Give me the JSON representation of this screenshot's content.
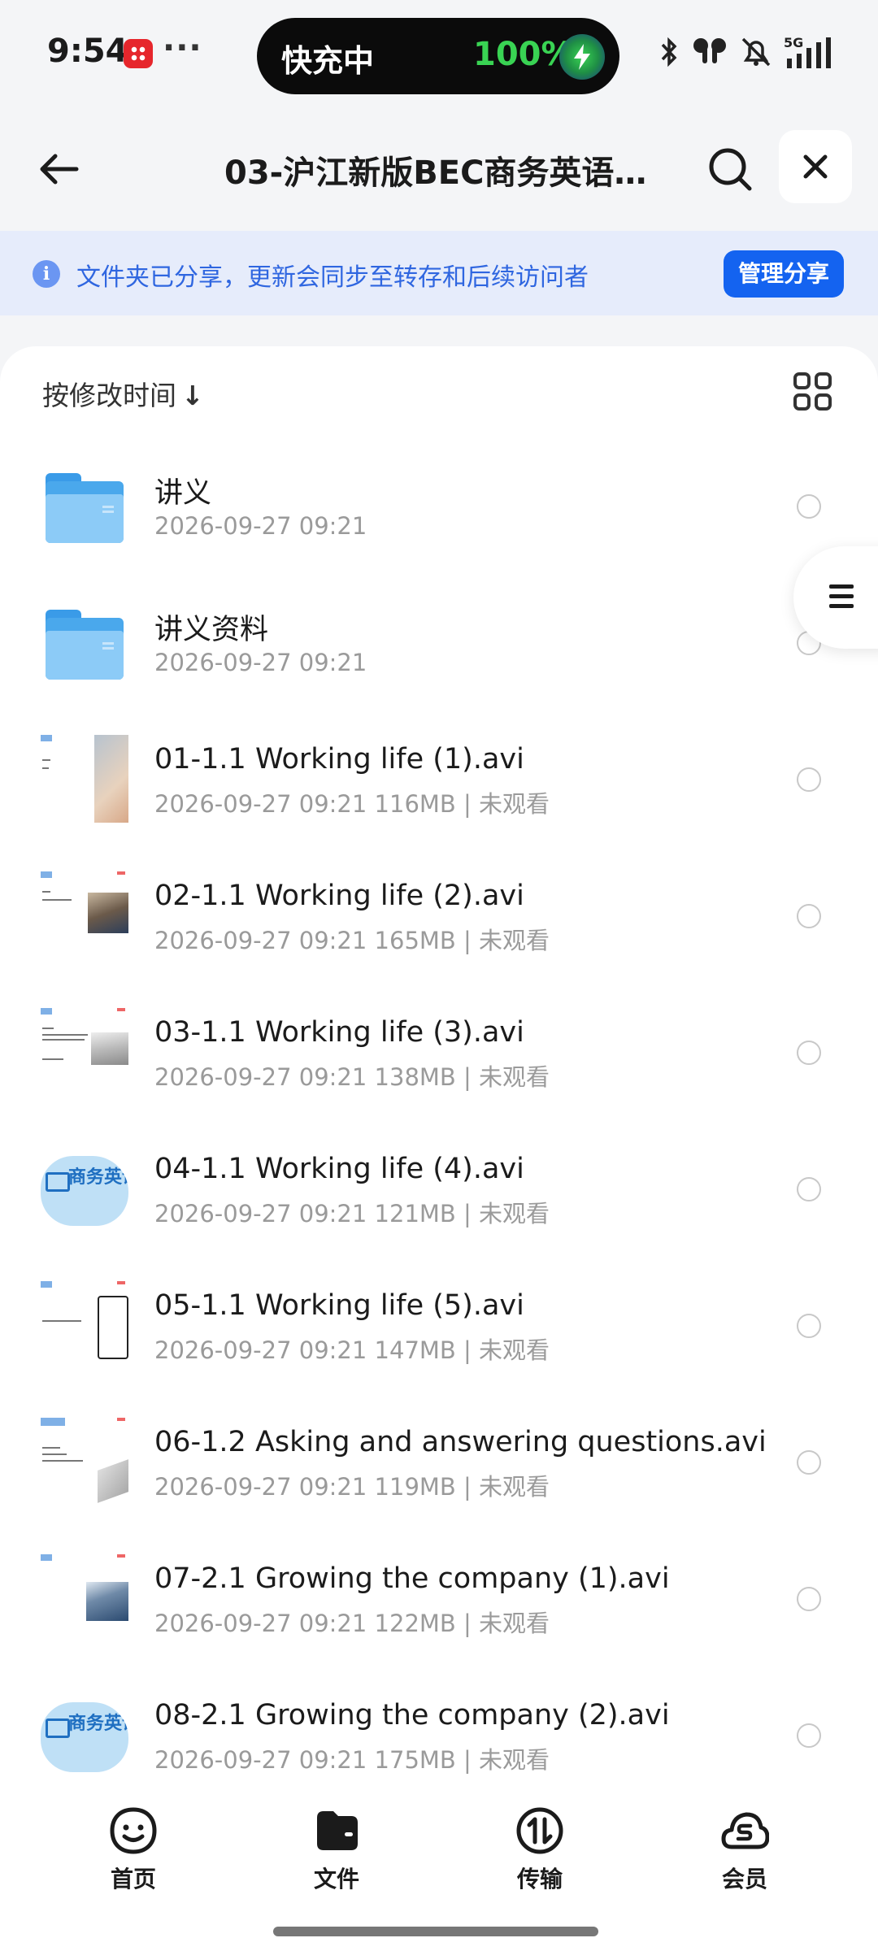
{
  "status_bar": {
    "time": "9:54",
    "more": "···",
    "island_label": "快充中",
    "battery_percent": "100%",
    "network": "5G"
  },
  "header": {
    "title": "03-沪江新版BEC商务英语…"
  },
  "banner": {
    "info_icon": "i",
    "text": "文件夹已分享，更新会同步至转存和后续访问者",
    "button": "管理分享"
  },
  "list": {
    "sort_label": "按修改时间",
    "sort_arrow": "↓",
    "items": [
      {
        "type": "folder",
        "name": "讲义",
        "meta": "2026-09-27 09:21"
      },
      {
        "type": "folder",
        "name": "讲义资料",
        "meta": "2026-09-27 09:21"
      },
      {
        "type": "video",
        "name": "01-1.1 Working life (1).avi",
        "meta": "2026-09-27 09:21  116MB | 未观看"
      },
      {
        "type": "video",
        "name": "02-1.1 Working life (2).avi",
        "meta": "2026-09-27 09:21  165MB | 未观看"
      },
      {
        "type": "video",
        "name": "03-1.1 Working life (3).avi",
        "meta": "2026-09-27 09:21  138MB | 未观看"
      },
      {
        "type": "video",
        "name": "04-1.1 Working life (4).avi",
        "meta": "2026-09-27 09:21  121MB | 未观看"
      },
      {
        "type": "video",
        "name": "05-1.1 Working life (5).avi",
        "meta": "2026-09-27 09:21  147MB | 未观看"
      },
      {
        "type": "video",
        "name": "06-1.2 Asking and answering questions.avi",
        "meta": "2026-09-27 09:21  119MB | 未观看"
      },
      {
        "type": "video",
        "name": "07-2.1 Growing the company (1).avi",
        "meta": "2026-09-27 09:21  122MB | 未观看"
      },
      {
        "type": "video",
        "name": "08-2.1 Growing the company (2).avi",
        "meta": "2026-09-27 09:21  175MB | 未观看"
      }
    ],
    "thumb_text": "商务英语"
  },
  "bottom_nav": [
    {
      "label": "首页",
      "icon": "smile-face-icon"
    },
    {
      "label": "文件",
      "icon": "folder-file-icon"
    },
    {
      "label": "传输",
      "icon": "transfer-icon"
    },
    {
      "label": "会员",
      "icon": "cloud-member-icon"
    }
  ],
  "colors": {
    "accent": "#1463f0",
    "banner_bg": "#e6ecfb",
    "banner_text": "#2f66e0",
    "folder": "#4aa8ec"
  }
}
